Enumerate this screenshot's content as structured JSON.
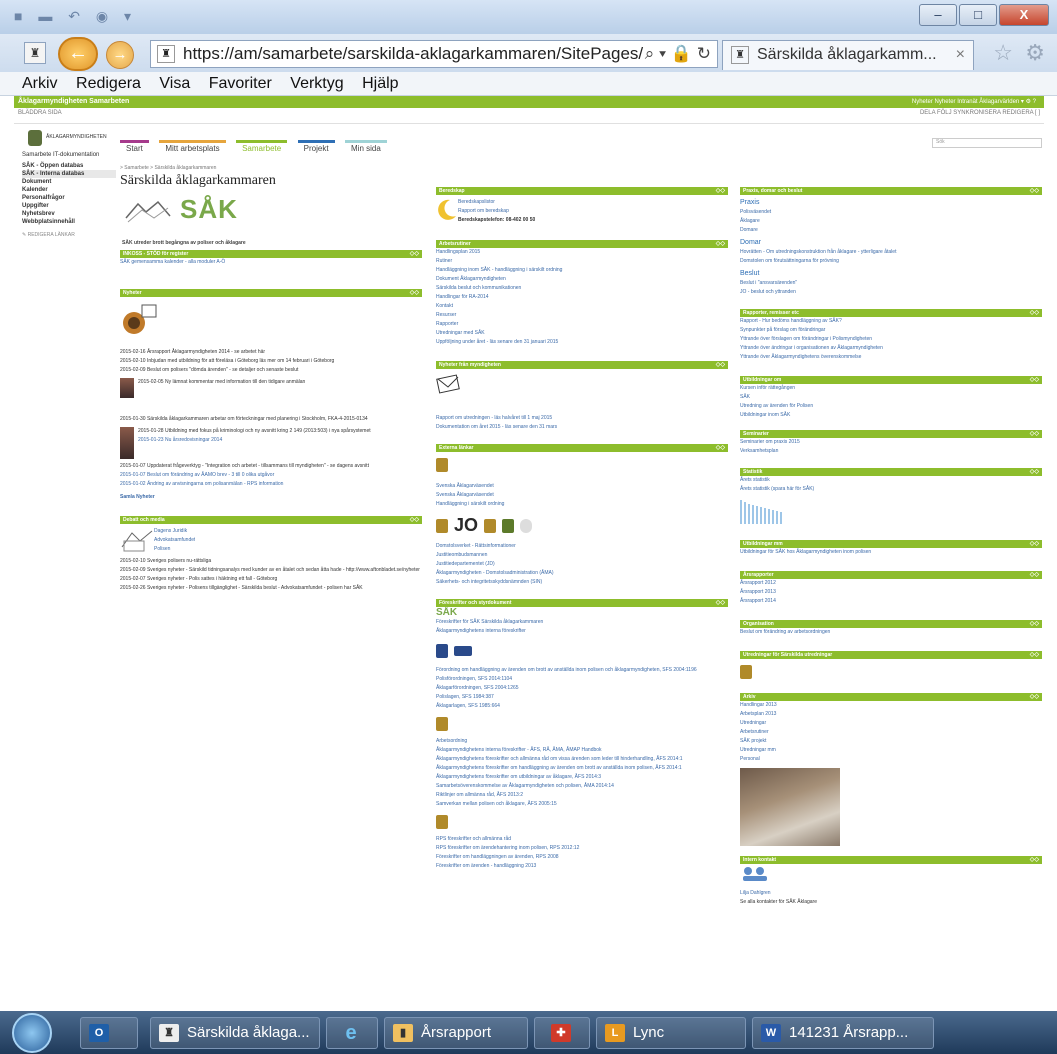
{
  "browser": {
    "url": "https://am/samarbete/sarskilda-aklagarkammaren/SitePages/",
    "tab_title": "Särskilda åklagarkamm...",
    "tab_close": "×",
    "menu": [
      "Arkiv",
      "Redigera",
      "Visa",
      "Favoriter",
      "Verktyg",
      "Hjälp"
    ],
    "window_buttons": [
      "–",
      "□",
      "X"
    ]
  },
  "suite": {
    "title": "Åklagarmyndigheten Samarbeten",
    "right_links": "Nyheter  Nyheter  Intranät   Åklagarvärlden ▾  ⚙  ?",
    "ribbon_left": "BLÄDDRA   SIDA",
    "ribbon_right": "DELA   FÖLJ   SYNKRONISERA   REDIGERA   [ ]"
  },
  "header": {
    "logo_text": "ÅKLAGARMYNDIGHETEN",
    "tabs": [
      "Start",
      "Mitt arbetsplats",
      "Samarbete",
      "Projekt",
      "Min sida"
    ],
    "search_placeholder": "Sök"
  },
  "leftnav": {
    "heading": "Samarbete   IT-dokumentation",
    "items": [
      "SÅK - Öppen databas",
      "SÅK - Interna databas",
      "Dokument",
      "Kalender",
      "Personalfrågor",
      "Uppgifter",
      "Nyhetsbrev",
      "Webbplatsinnehåll"
    ],
    "edit": "✎ REDIGERA LÄNKAR"
  },
  "main": {
    "breadcrumb": "> Samarbete > Särskilda åklagarkammaren",
    "title": "Särskilda åklagarkammaren",
    "sak_name": "SÅK",
    "sak_caption": "SÅK utreder brott begångna av poliser och åklagare",
    "news_head": "Nyheter",
    "col1": {
      "box1": {
        "head": "INKOSS - STÖD för register",
        "lines": [
          "SÅK gemensamma kalender - alla moduler A-Ö"
        ]
      },
      "box2": {
        "head": "Nyheter",
        "items": [
          "2015-02-16  Årsrapport Åklagarmyndigheten 2014 - se arbetet här",
          "2015-02-10  Inbjudan med utbildning för att föreläsa i Göteborg läs mer om 14 februari i Göteborg",
          "2015-02-09  Beslut om polisers \"dömda ärenden\" - se detaljer och senaste beslut"
        ],
        "with_thumb1": "2015-02-05  Ny lämnat kommentar med information till den tidigare anmälan",
        "middle": "2015-01-30  Särskilda åklagarkammaren arbetar om förteckningar med planering i Stockholm, FKA-4-2015-0134",
        "with_thumb2": "2015-01-28  Utbildning med fokus på kriminologi och ny avsnitt kring 2 149 (2013:503) i nya spårsystemet",
        "sub2": "2015-01-23  Nu årsredovisningar 2014",
        "more": [
          "2015-01-07  Uppdaterat frågeverktyg - \"Integration och arbetet - tillsammans till myndigheten\" - se dagens avsnitt",
          "2015-01-07  Beslut om förändring av ÅAMO brev - 3 till 0 olika utgåvor",
          "2015-01-02  Ändring av anvisningarna om polisanmälan - RPS information"
        ],
        "link": "Samla Nyheter"
      },
      "box3": {
        "head": "Debatt och media",
        "people": [
          "Dagens Juridik",
          "Advokatsamfundet",
          "Polisen"
        ],
        "items": [
          "2015-02-10  Sveriges polisers nu-rättsliga",
          "2015-02-09  Sveriges nyheter - Särskild tidningsanalys med kunder av en åtalet och sedan åtta hade - http://www.aftonbladet.se/nyheter",
          "2015-02-07  Sveriges nyheter - Polis sattes i häktning ett fall - Göteborg",
          "2015-02-26  Sveriges nyheter - Polisens tillgänglighet - Särskilda beslut - Advokatsamfundet - polisen har SÅK"
        ]
      }
    },
    "col2": {
      "box1": {
        "head": "Beredskap",
        "lines": [
          "Beredskapslistor",
          "Rapport om beredskap",
          "Beredskapstelefon: 08-402 00 50"
        ]
      },
      "box2": {
        "head": "Arbetsrutiner",
        "lines": [
          "Handlingsplan 2015",
          "Rutiner",
          "Handläggning inom SÅK - handläggning i särskilt ordning",
          "",
          "Dokument Åklagarmyndigheten",
          "Särskilda beslut och kommunikationen",
          "Handlingar för RA-2014",
          "",
          "Kontakt",
          "Resurser",
          "Rapporter",
          "",
          "Utredningar med SÅK",
          "",
          "Uppföljning under året - läs senare den 31 januari 2015"
        ]
      },
      "box3": {
        "head": "Nyheter från myndigheten",
        "lines": [
          "Rapport om utredningen - läs halvåret till 1 maj 2015",
          "Dokumentation om året 2015 - läs senare den 31 mars"
        ]
      },
      "box4": {
        "head": "Externa länkar",
        "lines": [
          "Svenska Åklagarväsendet",
          "Svenska Åklagarväsendet",
          "Handläggning i särskilt ordning"
        ],
        "jo_text": "JO",
        "links2": [
          "Domstolsverket - Rättsinformationer",
          "Justitieombudsmannen",
          "Justitiedepartementet (JD)",
          "Åklagarmyndigheten - Domstolsadministration (ÅMA)",
          "Säkerhets- och integritetsskyddsnämnden (SIN)"
        ]
      },
      "box5": {
        "head": "Föreskrifter och styrdokument",
        "sak_name": "SÅK",
        "lines_a": [
          "Föreskrifter för SÅK Särskilda åklagarkammaren",
          "Åklagarmyndighetens interna föreskrifter"
        ],
        "lines_b": [
          "Förordning om handläggning av ärenden om brott av anställda inom polisen och åklagarmyndigheten, SFS 2004:1196",
          "Polisförordningen, SFS 2014:1104",
          "Åklagarförordningen, SFS 2004:1265",
          "Polislagen, SFS 1984:387",
          "Åklagarlagen, SFS 1985:664"
        ],
        "lines_c": [
          "Arbetsordning",
          "Åklagarmyndighetens interna föreskrifter - ÅFS, RÅ, ÅMA, ÅMAP Handbok",
          "Åklagarmyndighetens föreskrifter och allmänna råd om vissa ärenden som leder till hinderhandling, ÅFS 2014:1",
          "Åklagarmyndighetens föreskrifter om handläggning av ärenden om brott av anställda inom polisen, ÅFS 2014:1",
          "Åklagarmyndighetens föreskrifter om utbildningar av åklagare, ÅFS 2014:3",
          "Samarbetsöverenskommelse av Åklagarmyndigheten och polisen, ÅMA 2014:14",
          "Riktlinjer om allmänna råd, ÅFS 2013:2",
          "Samverkan mellan polisen och åklagare, ÅFS 2005:15"
        ],
        "lines_d": [
          "RPS föreskrifter och allmänna råd",
          "RPS föreskrifter om ärendehantering inom polisen, RPS 2012:12",
          "Föreskrifter om handläggningen av ärenden, RPS 2008",
          "Föreskrifter om ärenden - handläggning 2013"
        ]
      }
    },
    "col3": {
      "box1": {
        "head": "Praxis, domar och beslut",
        "sub1": "Praxis",
        "praxis": [
          "Polisväsendet",
          "Åklagare",
          "Domare"
        ],
        "sub2": "Domar",
        "domar": [
          "Hovrätten - Om utredningskonstruktion från åklagare - ytterligare åtalet",
          "Domstolen om förutsättningarna för prövning"
        ],
        "sub3": "Beslut",
        "beslut": [
          "Beslut i \"ansvarsärenden\"",
          "JO - beslut och yttranden"
        ]
      },
      "box2": {
        "head": "Rapporter, remisser etc",
        "lines": [
          "Rapport - Hur bedöms handläggning av SÅK?",
          "Synpunkter på förslag om förändringar",
          "Yttrande över förslagen om förändringar i Polismyndigheten",
          "Yttrande över ändringar i organisationen av Åklagarmyndigheten",
          "Yttrande över Åklagarmyndighetens överenskommelse"
        ]
      },
      "box3": {
        "head": "Utbildningar om",
        "lines": [
          "Kursen inför rättegången",
          "SÅK",
          "Utredning av ärenden för Polisen",
          "Utbildningar inom SÅK"
        ]
      },
      "box4": {
        "head": "Seminarier",
        "lines": [
          "Seminarier om praxis 2015",
          "Verksamhetsplan"
        ]
      },
      "box5": {
        "head": "Statistik",
        "lines": [
          "Årets statistik",
          "Årets statistik (spara här för SÅK)"
        ]
      },
      "box6": {
        "head": "Utbildningar mm",
        "lines": [
          "Utbildningar för SÅK hos Åklagarmyndigheten inom polisen"
        ]
      },
      "box7": {
        "head": "Årsrapporter",
        "lines": [
          "Årsrapport 2012",
          "Årsrapport 2013",
          "Årsrapport 2014"
        ]
      },
      "box8": {
        "head": "Organisation",
        "lines": [
          "Beslut om förändring av arbetsordningen"
        ]
      },
      "box9": {
        "head": "Utredningar för Särskilda utredningar"
      },
      "box10": {
        "head": "Arkiv",
        "lines": [
          "Handlingar 2013",
          "Arbetsplan 2013",
          "Utredningar",
          "Arbetsrutiner",
          "SÅK projekt",
          "Utredningar mm",
          "Personal"
        ]
      },
      "box11": {
        "head": "Intern kontakt",
        "lines": [
          "Lilja Dahlgren",
          "Se alla kontakter för SÅK Åklagare"
        ]
      }
    }
  },
  "taskbar": {
    "items": [
      "Särskilda åklaga...",
      "",
      "Årsrapport",
      "",
      "Lync",
      "141231 Årsrapp..."
    ]
  }
}
